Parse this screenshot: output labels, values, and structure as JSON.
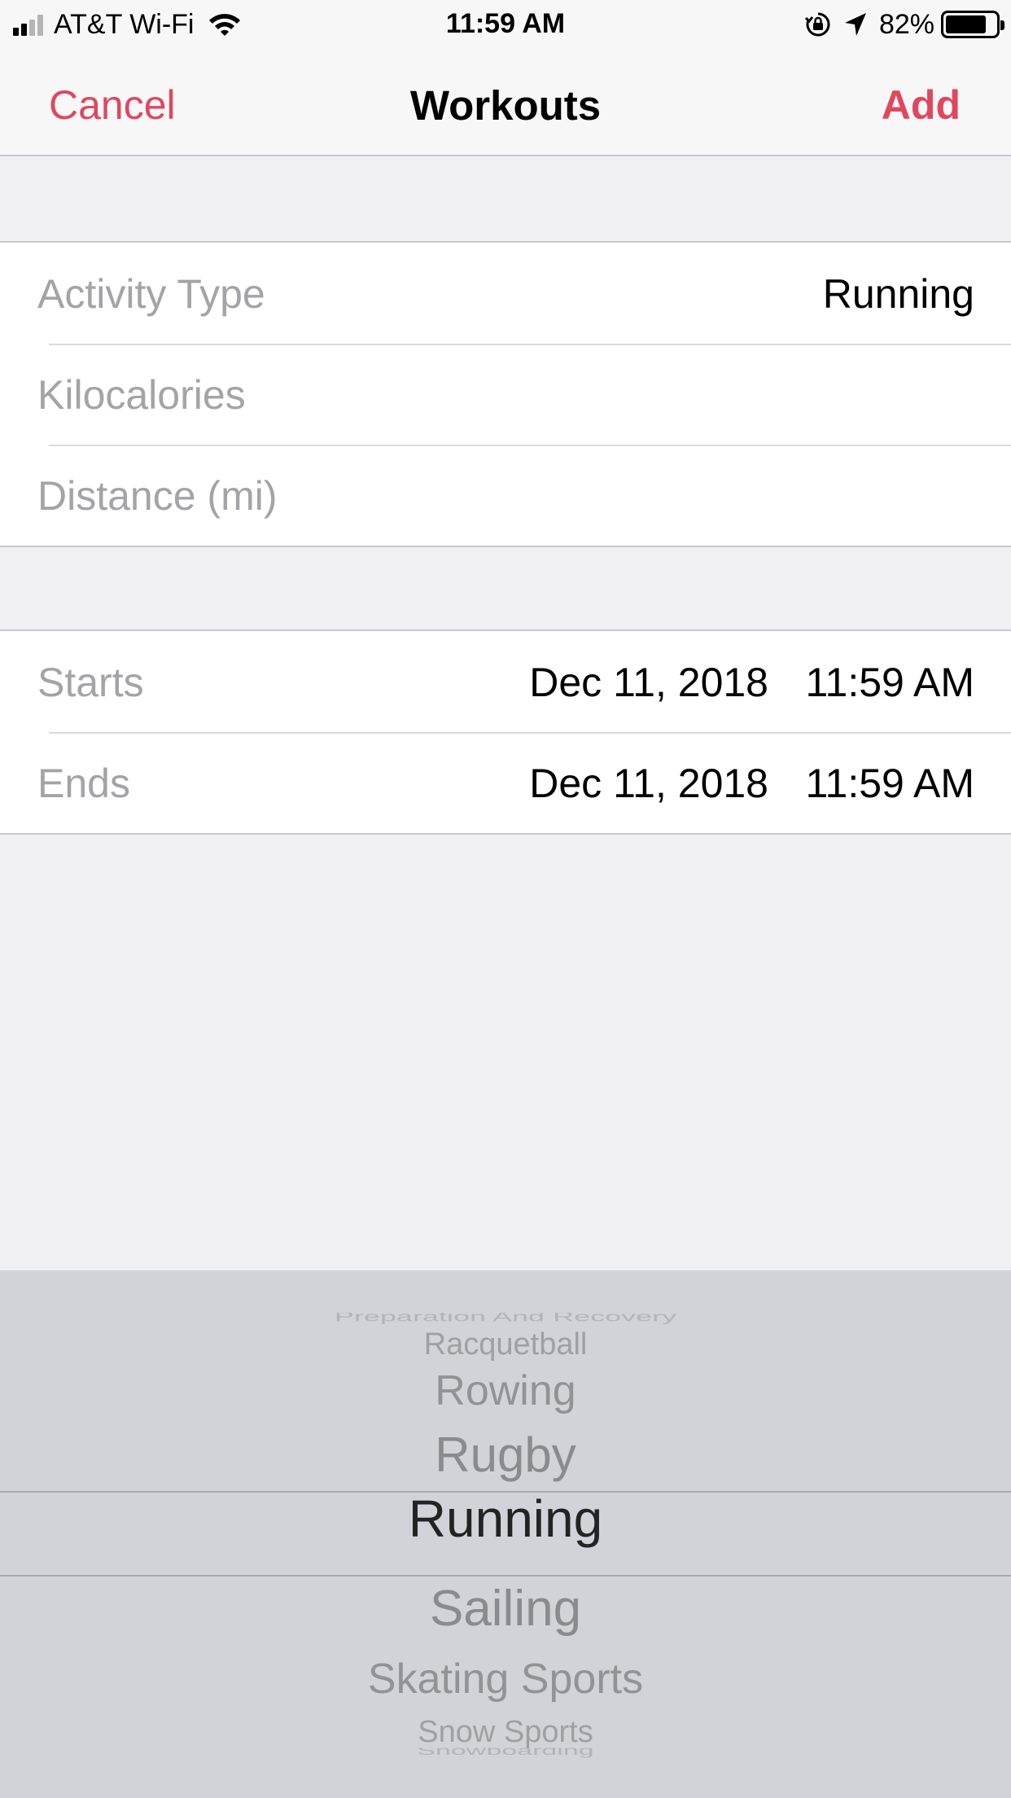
{
  "status_bar": {
    "carrier": "AT&T Wi-Fi",
    "time": "11:59 AM",
    "battery": "82%",
    "battery_level": 0.82,
    "signal_bars_filled": 2,
    "signal_bars_total": 4,
    "icons": [
      "signal-icon",
      "wifi-icon",
      "orientation-lock-icon",
      "location-arrow-icon",
      "battery-icon"
    ]
  },
  "nav": {
    "cancel_label": "Cancel",
    "title": "Workouts",
    "add_label": "Add"
  },
  "form": {
    "activity_type": {
      "label": "Activity Type",
      "value": "Running"
    },
    "kilocalories": {
      "label": "Kilocalories",
      "value": ""
    },
    "distance": {
      "label": "Distance (mi)",
      "value": ""
    },
    "starts": {
      "label": "Starts",
      "date": "Dec 11, 2018",
      "time": "11:59 AM"
    },
    "ends": {
      "label": "Ends",
      "date": "Dec 11, 2018",
      "time": "11:59 AM"
    }
  },
  "picker": {
    "items": [
      "Preparation And Recovery",
      "Racquetball",
      "Rowing",
      "Rugby",
      "Running",
      "Sailing",
      "Skating Sports",
      "Snow Sports",
      "Snowboarding"
    ],
    "selected": "Running"
  },
  "colors": {
    "accent": "#e0475f",
    "background": "#efeff4",
    "picker_background": "#d2d3d8"
  }
}
